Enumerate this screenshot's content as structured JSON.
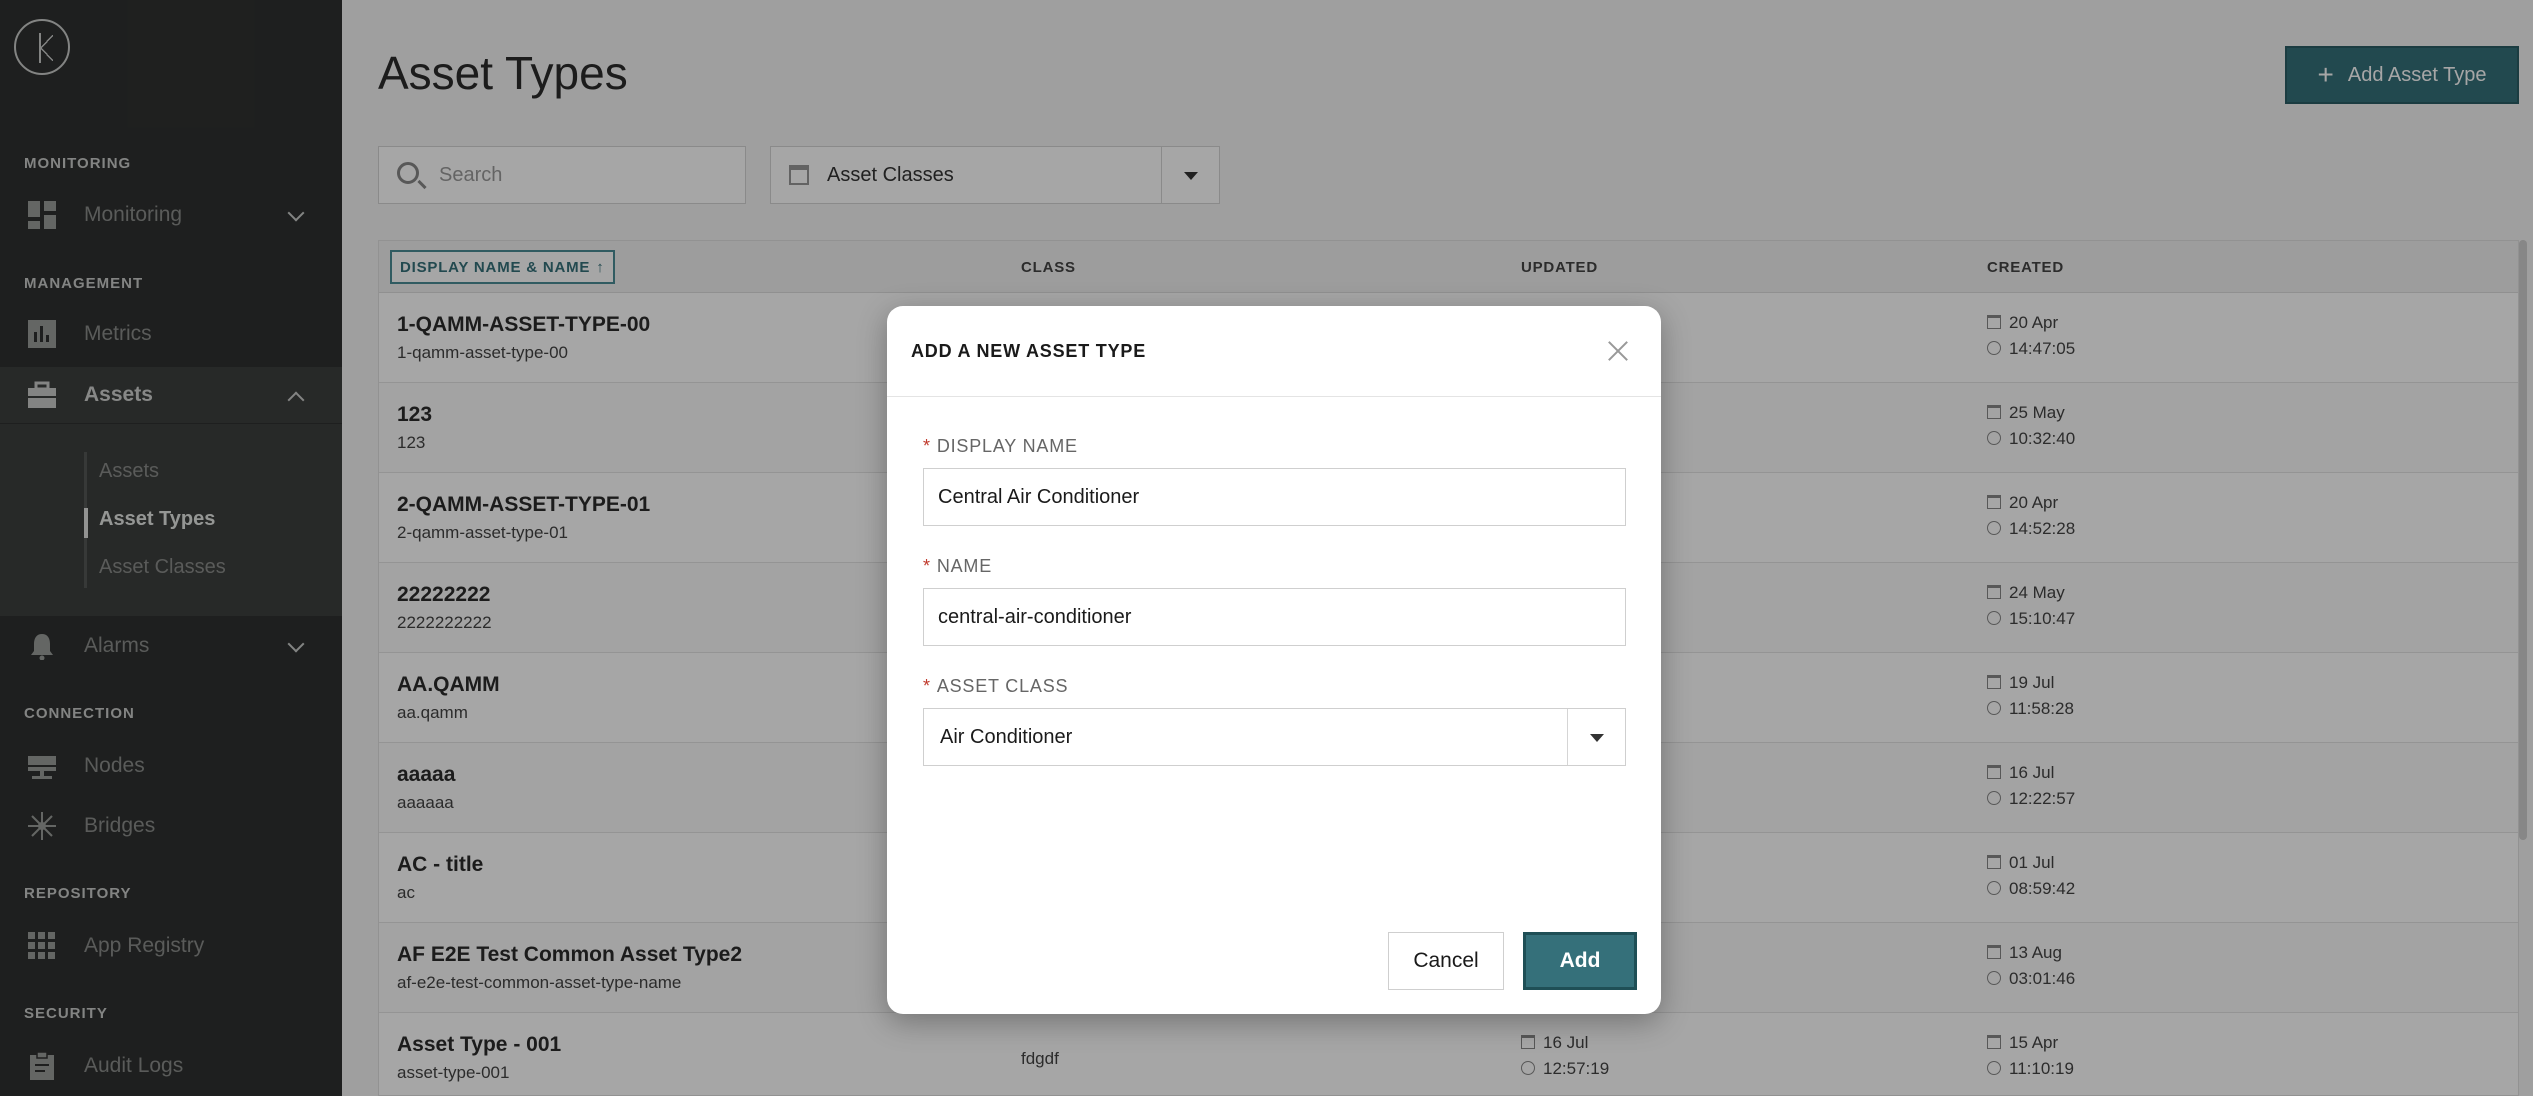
{
  "sidebar": {
    "sections": {
      "monitoring": "MONITORING",
      "management": "MANAGEMENT",
      "connection": "CONNECTION",
      "repository": "REPOSITORY",
      "security": "SECURITY"
    },
    "items": {
      "monitoring": "Monitoring",
      "metrics": "Metrics",
      "assets": "Assets",
      "alarms": "Alarms",
      "nodes": "Nodes",
      "bridges": "Bridges",
      "app_registry": "App Registry",
      "audit_logs": "Audit Logs"
    },
    "submenu": [
      "Assets",
      "Asset Types",
      "Asset Classes"
    ]
  },
  "main": {
    "title": "Asset Types",
    "add_button": "Add Asset Type",
    "search_placeholder": "Search",
    "filter_label": "Asset Classes",
    "columns": {
      "name": "DISPLAY NAME & NAME",
      "class": "CLASS",
      "updated": "UPDATED",
      "created": "CREATED"
    },
    "rows": [
      {
        "display": "1-QAMM-ASSET-TYPE-00",
        "name": "1-qamm-asset-type-00",
        "class": "",
        "updated_date": "",
        "updated_time": "",
        "created_date": "20 Apr",
        "created_time": "14:47:05"
      },
      {
        "display": "123",
        "name": "123",
        "class": "",
        "updated_date": "",
        "updated_time": "",
        "created_date": "25 May",
        "created_time": "10:32:40"
      },
      {
        "display": "2-QAMM-ASSET-TYPE-01",
        "name": "2-qamm-asset-type-01",
        "class": "",
        "updated_date": "",
        "updated_time": "",
        "created_date": "20 Apr",
        "created_time": "14:52:28"
      },
      {
        "display": "22222222",
        "name": "2222222222",
        "class": "",
        "updated_date": "",
        "updated_time": "",
        "created_date": "24 May",
        "created_time": "15:10:47"
      },
      {
        "display": "AA.QAMM",
        "name": "aa.qamm",
        "class": "",
        "updated_date": "",
        "updated_time": "",
        "created_date": "19 Jul",
        "created_time": "11:58:28"
      },
      {
        "display": "aaaaa",
        "name": "aaaaaa",
        "class": "",
        "updated_date": "",
        "updated_time": "",
        "created_date": "16 Jul",
        "created_time": "12:22:57"
      },
      {
        "display": "AC - title",
        "name": "ac",
        "class": "",
        "updated_date": "",
        "updated_time": "",
        "created_date": "01 Jul",
        "created_time": "08:59:42"
      },
      {
        "display": "AF E2E Test Common Asset Type2",
        "name": "af-e2e-test-common-asset-type-name",
        "class": "",
        "updated_date": "",
        "updated_time": "",
        "created_date": "13 Aug",
        "created_time": "03:01:46"
      },
      {
        "display": "Asset Type - 001",
        "name": "asset-type-001",
        "class": "fdgdf",
        "updated_date": "16 Jul",
        "updated_time": "12:57:19",
        "created_date": "15 Apr",
        "created_time": "11:10:19"
      }
    ]
  },
  "modal": {
    "title": "ADD A NEW ASSET TYPE",
    "display_name_label": "DISPLAY NAME",
    "display_name_value": "Central Air Conditioner",
    "name_label": "NAME",
    "name_value": "central-air-conditioner",
    "asset_class_label": "ASSET CLASS",
    "asset_class_value": "Air Conditioner",
    "required_mark": "*",
    "cancel_label": "Cancel",
    "add_label": "Add"
  },
  "colors": {
    "sidebar_bg": "#2f3130",
    "accent": "#35707a",
    "required": "#c0392b"
  }
}
